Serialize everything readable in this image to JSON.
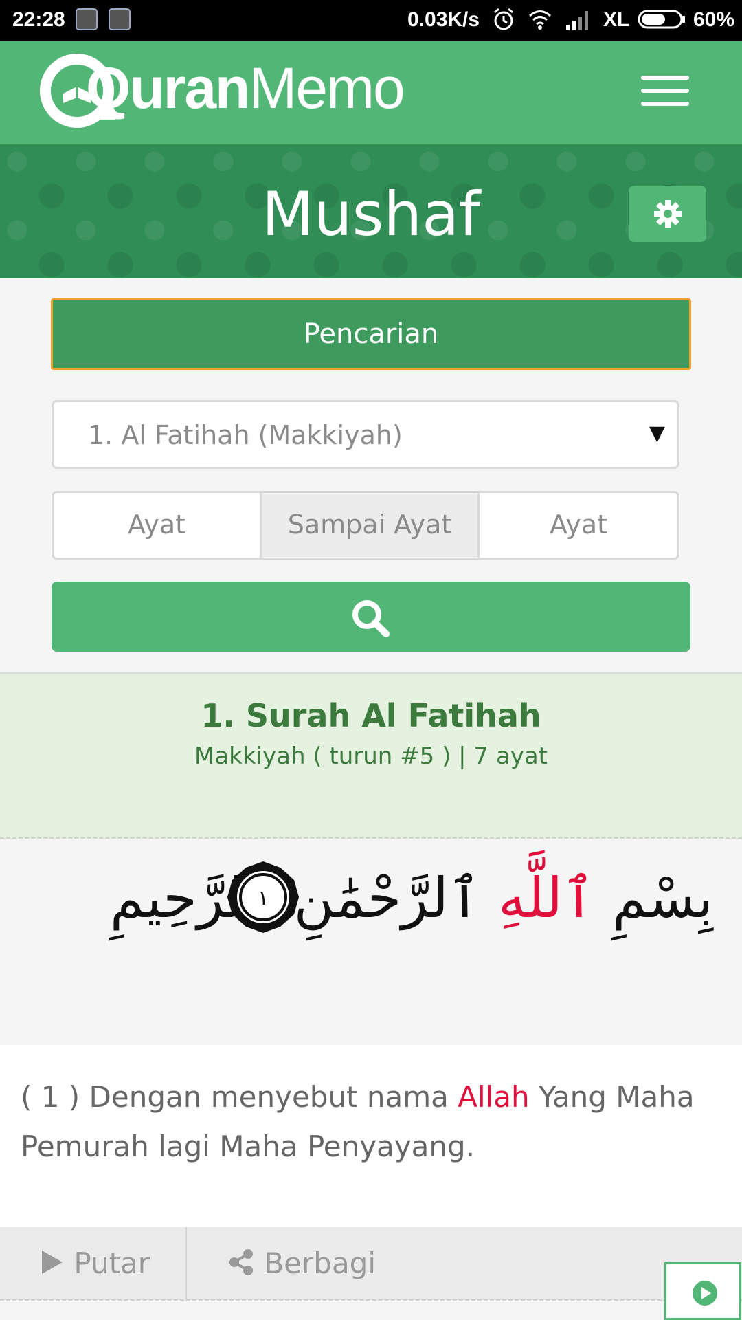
{
  "status_bar": {
    "time": "22:28",
    "network_speed": "0.03K/s",
    "carrier": "XL",
    "battery": "60%"
  },
  "header": {
    "logo_bold": "Quran",
    "logo_light": "Memo"
  },
  "banner": {
    "title": "Mushaf"
  },
  "search": {
    "header_label": "Pencarian",
    "surah_select_value": "1. Al Fatihah (Makkiyah)",
    "ayat_from_placeholder": "Ayat",
    "ayat_middle_label": "Sampai Ayat",
    "ayat_to_placeholder": "Ayat"
  },
  "surah": {
    "title": "1. Surah Al Fatihah",
    "meta": "Makkiyah ( turun #5 ) | 7 ayat"
  },
  "verse": {
    "arabic_pre": "بِسْمِ ",
    "arabic_allah": "ٱللَّهِ",
    "arabic_post": " ٱلرَّحْمَٰنِ ٱلرَّحِيمِ",
    "number_ar": "١",
    "translation_pre": "( 1 ) Dengan menyebut nama ",
    "translation_allah": "Allah",
    "translation_post": " Yang Maha Pemurah lagi Maha Penyayang."
  },
  "actions": {
    "play_label": "Putar",
    "share_label": "Berbagi"
  },
  "colors": {
    "primary_green": "#52b677",
    "dark_green": "#3e9a5d",
    "highlight_red": "#e0103c",
    "surah_bg": "#e5f2e0"
  }
}
